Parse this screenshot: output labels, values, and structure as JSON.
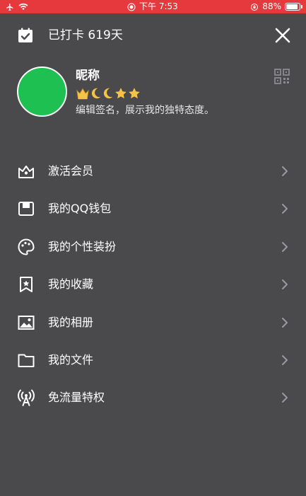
{
  "status_bar": {
    "time": "下午 7:53",
    "battery": "88%",
    "battery_level": 0.88
  },
  "header": {
    "checkin_text": "已打卡 619天"
  },
  "profile": {
    "nickname": "昵称",
    "signature": "编辑签名，展示我的独特态度。",
    "badges": [
      "crown",
      "moon",
      "moon",
      "star",
      "star"
    ]
  },
  "menu": [
    {
      "label": "激活会员",
      "icon": "vip-crown-icon"
    },
    {
      "label": "我的QQ钱包",
      "icon": "wallet-icon"
    },
    {
      "label": "我的个性装扮",
      "icon": "palette-icon"
    },
    {
      "label": "我的收藏",
      "icon": "bookmark-icon"
    },
    {
      "label": "我的相册",
      "icon": "album-icon"
    },
    {
      "label": "我的文件",
      "icon": "folder-icon"
    },
    {
      "label": "免流量特权",
      "icon": "signal-tower-icon"
    }
  ],
  "colors": {
    "status_bar": "#e5393d",
    "background": "#4a4a4d",
    "avatar": "#1ec052",
    "badge_gold": "#f6c344"
  }
}
